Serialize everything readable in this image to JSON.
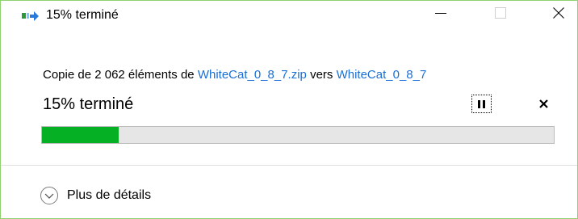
{
  "window": {
    "title": "15% terminé",
    "icons": {
      "title_icon": "file-copy-icon",
      "minimize": "minimize-icon",
      "maximize": "maximize-icon",
      "close": "close-icon"
    }
  },
  "operation": {
    "prefix": "Copie de 2 062 éléments de ",
    "source": "WhiteCat_0_8_7.zip",
    "middle": " vers ",
    "destination": "WhiteCat_0_8_7",
    "status": "15% terminé",
    "progress_percent": 15
  },
  "controls": {
    "pause_icon": "pause-icon",
    "cancel_icon": "cancel-icon"
  },
  "details": {
    "label": "Plus de détails",
    "icon": "chevron-down-circle-icon"
  },
  "colors": {
    "progress_fill": "#06b025",
    "link": "#1a6fd6",
    "window_border": "#8fd16f"
  }
}
